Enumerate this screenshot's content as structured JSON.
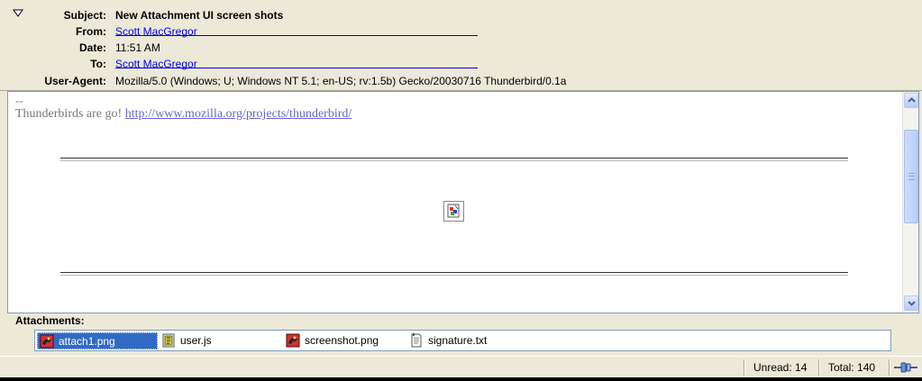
{
  "header": {
    "subject_label": "Subject:",
    "subject": "New Attachment UI screen shots",
    "from_label": "From:",
    "from": "Scott MacGregor",
    "date_label": "Date:",
    "date": "11:51 AM",
    "to_label": "To:",
    "to": "Scott MacGregor",
    "useragent_label": "User-Agent:",
    "useragent": "Mozilla/5.0 (Windows; U; Windows NT 5.1; en-US; rv:1.5b) Gecko/20030716 Thunderbird/0.1a"
  },
  "body": {
    "sig_separator": "--",
    "sig_text": "Thunderbirds are go!",
    "sig_link": "http://www.mozilla.org/projects/thunderbird/"
  },
  "attachments": {
    "label": "Attachments:",
    "items": [
      {
        "name": "attach1.png",
        "icon": "png-image-icon",
        "selected": true
      },
      {
        "name": "user.js",
        "icon": "script-file-icon",
        "selected": false
      },
      {
        "name": "screenshot.png",
        "icon": "png-image-icon",
        "selected": false
      },
      {
        "name": "signature.txt",
        "icon": "text-file-icon",
        "selected": false
      }
    ]
  },
  "status": {
    "unread": "Unread: 14",
    "total": "Total: 140"
  },
  "colors": {
    "chrome": "#ece9d8",
    "link": "#0000ee",
    "selection": "#316ac5"
  }
}
